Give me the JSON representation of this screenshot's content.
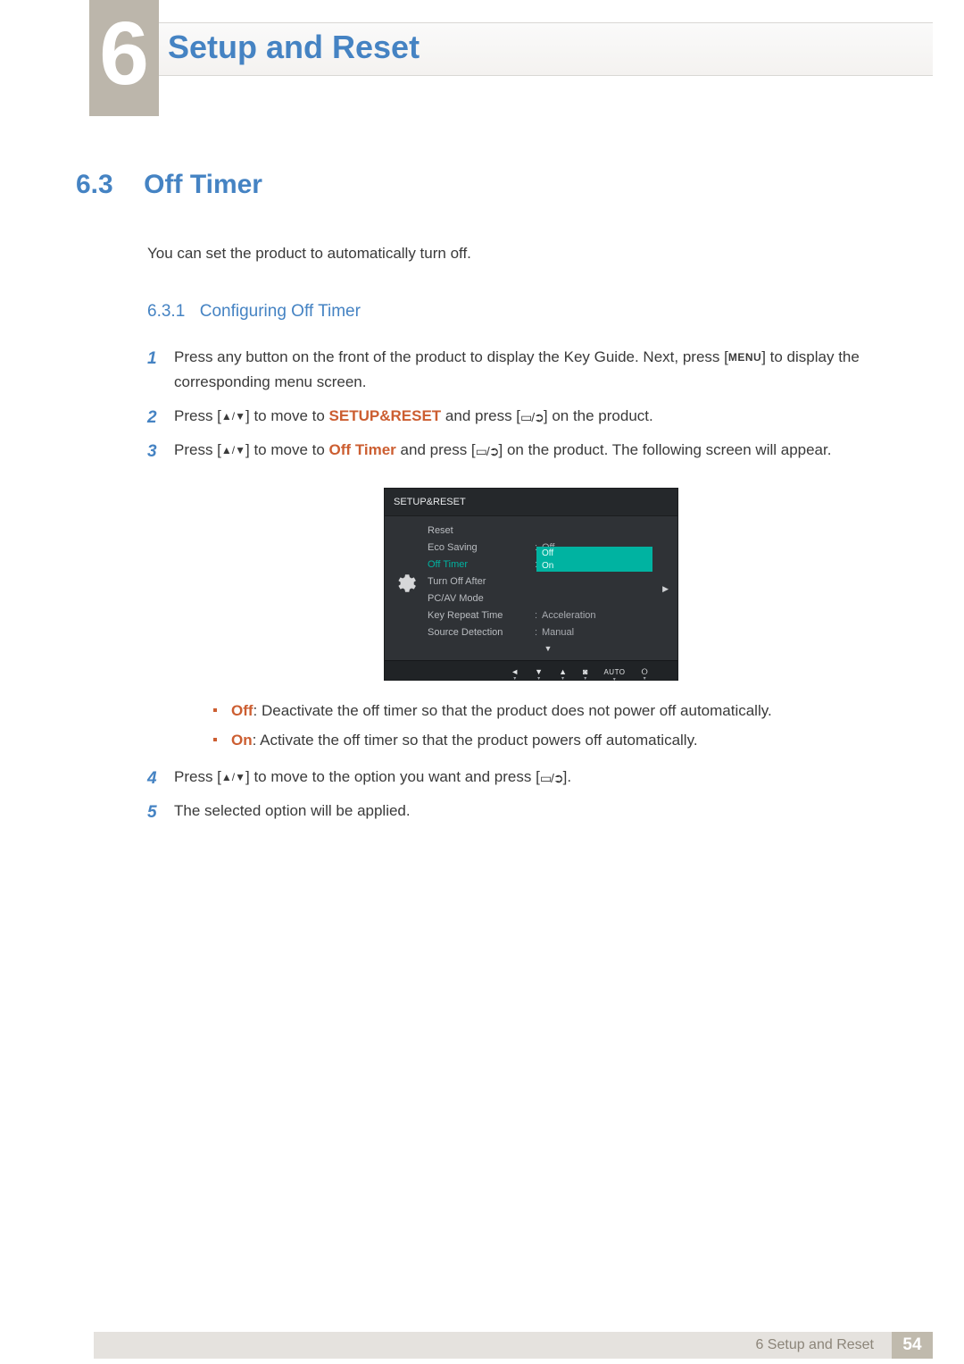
{
  "header": {
    "chapter_num": "6",
    "chapter_title": "Setup and Reset"
  },
  "section": {
    "num": "6.3",
    "title": "Off Timer",
    "intro": "You can set the product to automatically turn off."
  },
  "subsection": {
    "num": "6.3.1",
    "title": "Configuring Off Timer"
  },
  "steps": {
    "s1a": "Press any button on the front of the product to display the Key Guide. Next, press [",
    "s1_menu": "MENU",
    "s1b": "] to display the corresponding menu screen.",
    "s2a": "Press [",
    "s2b": "] to move to ",
    "s2_kw": "SETUP&RESET",
    "s2c": " and press [",
    "s2d": "] on the product.",
    "s3a": "Press [",
    "s3b": "] to move to ",
    "s3_kw": "Off Timer",
    "s3c": " and press [",
    "s3d": "] on the product. The following screen will appear.",
    "s4a": "Press [",
    "s4b": "] to move to the option you want and press [",
    "s4c": "].",
    "s5": "The selected option will be applied."
  },
  "bullets": {
    "off_kw": "Off",
    "off_text": ": Deactivate the off timer so that the product does not power off automatically.",
    "on_kw": "On",
    "on_text": ": Activate the off timer so that the product powers off automatically."
  },
  "osd": {
    "title": "SETUP&RESET",
    "rows": {
      "reset": "Reset",
      "eco_l": "Eco Saving",
      "eco_v": "Off",
      "offt_l": "Off Timer",
      "toa_l": "Turn Off After",
      "pcav_l": "PC/AV Mode",
      "kr_l": "Key Repeat Time",
      "kr_v": "Acceleration",
      "sd_l": "Source Detection",
      "sd_v": "Manual"
    },
    "dd": {
      "opt1": "Off",
      "opt2": "On"
    },
    "foot": {
      "auto": "AUTO"
    }
  },
  "footer": {
    "text": "6 Setup and Reset",
    "page": "54"
  }
}
